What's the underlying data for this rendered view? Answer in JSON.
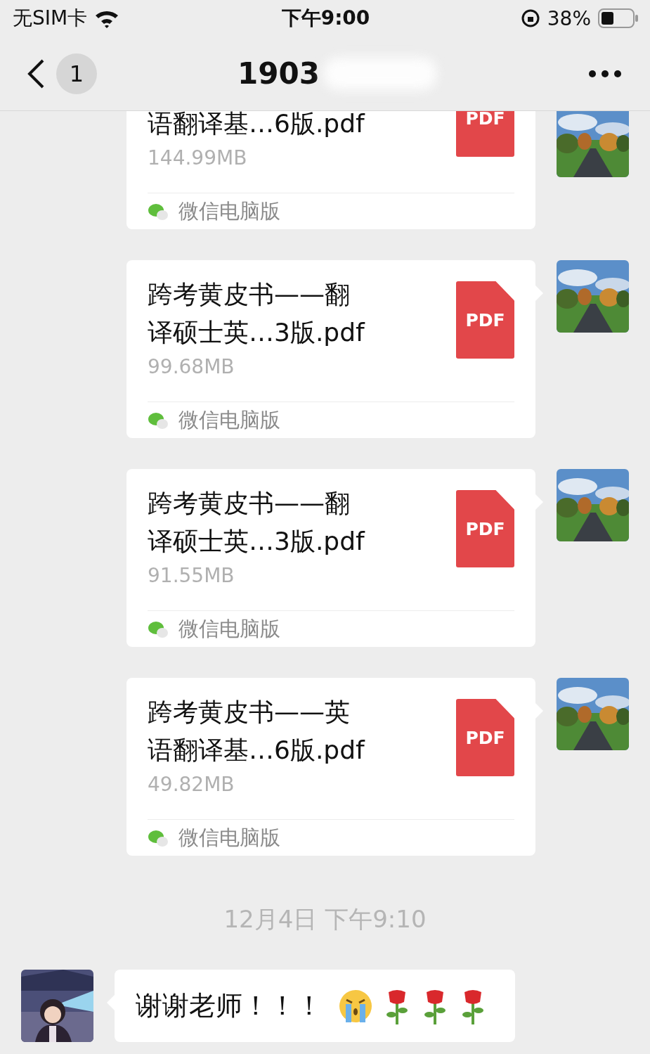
{
  "status_bar": {
    "carrier": "无SIM卡",
    "time": "下午9:00",
    "battery": "38%"
  },
  "nav": {
    "unread": "1",
    "title": "1903"
  },
  "messages": [
    {
      "kind": "file",
      "partial": true,
      "title": "语翻译基…6版.pdf",
      "file_type": "PDF",
      "size": "144.99MB",
      "source": "微信电脑版"
    },
    {
      "kind": "file",
      "partial": false,
      "title": "跨考黄皮书——翻译硕士英…3版.pdf",
      "file_type": "PDF",
      "size": "99.68MB",
      "source": "微信电脑版"
    },
    {
      "kind": "file",
      "partial": false,
      "title": "跨考黄皮书——翻译硕士英…3版.pdf",
      "file_type": "PDF",
      "size": "91.55MB",
      "source": "微信电脑版"
    },
    {
      "kind": "file",
      "partial": false,
      "title": "跨考黄皮书——英语翻译基…6版.pdf",
      "file_type": "PDF",
      "size": "49.82MB",
      "source": "微信电脑版"
    },
    {
      "kind": "time",
      "text": "12月4日 下午9:10"
    },
    {
      "kind": "text",
      "text": "谢谢老师！！！"
    }
  ]
}
